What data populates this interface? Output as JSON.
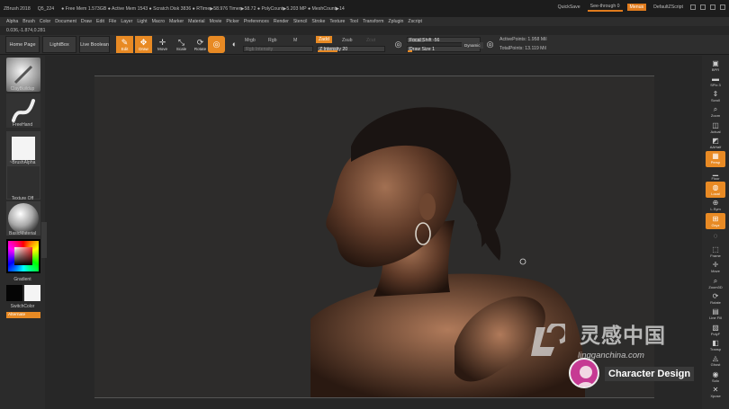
{
  "titlebar": {
    "app": "ZBrush 2018",
    "version": "Q5_224",
    "stats": "● Free Mem 1.573GB ● Active Mem 1543 ● Scratch Disk 3836 ● RTime▶58.976 Timer▶58.72 ● PolyCount▶5.203 MP ● MeshCount▶14",
    "quicksave": "QuickSave",
    "seethrough": "See-through  0",
    "menus": "Menus",
    "script": "DefaultZScript"
  },
  "menubar": [
    "Alpha",
    "Brush",
    "Color",
    "Document",
    "Draw",
    "Edit",
    "File",
    "Layer",
    "Light",
    "Macro",
    "Marker",
    "Material",
    "Movie",
    "Picker",
    "Preferences",
    "Render",
    "Stencil",
    "Stroke",
    "Texture",
    "Tool",
    "Transform",
    "Zplugin",
    "Zscript"
  ],
  "coords": "0.036,-1.874,0.281",
  "toolbar": {
    "home_page": "Home Page",
    "lightbox": "LightBox",
    "live_boolean": "Live Boolean",
    "edit": "Edit",
    "draw": "Draw",
    "move": "Move",
    "scale": "Scale",
    "rotate": "Rotate",
    "mrgb": "Mrgb",
    "rgb": "Rgb",
    "m": "M",
    "zadd": "Zadd",
    "zsub": "Zsub",
    "zcut": "Zcut",
    "rgb_intensity": "Rgb Intensity",
    "z_intensity": "Z Intensity 20",
    "focal_shift": "Focal Shift -56",
    "draw_size": "Draw Size 1",
    "dynamic": "Dynamic",
    "active_points": "ActivePoints: 1.958 Mil",
    "total_points": "TotalPoints: 13.119 Mil"
  },
  "leftpanel": {
    "brush": "ClayBuildup",
    "stroke": "FreeHand",
    "alpha": "~BrushAlpha",
    "texture": "Texture Off",
    "material": "BasicMaterial",
    "gradient": "Gradient",
    "switchcolor": "SwitchColor",
    "alternate": "Alternate"
  },
  "rightpanel": {
    "items": [
      "BPR",
      "SPix 3",
      "Scroll",
      "Zoom",
      "Actual",
      "AAHalf",
      "Persp",
      "Floor",
      "Local",
      "L.Sym",
      "Gxyz",
      "",
      "Frame",
      "Move",
      "Zoom3D",
      "Rotate",
      "Line Fill",
      "PolyF",
      "Transp",
      "Ghost",
      "Solo",
      "Xpose"
    ]
  },
  "watermark": {
    "cn": "灵感中国",
    "url": "lingganchina.com",
    "tag": "Character Design"
  },
  "colors": {
    "accent": "#e88a24",
    "bg": "#2a2a2a"
  }
}
